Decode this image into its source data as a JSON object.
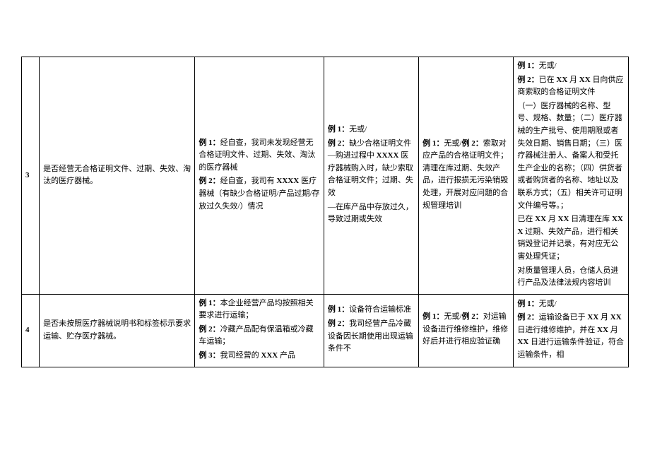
{
  "rows": [
    {
      "num": "3",
      "question": "是否经营无合格证明文件、过期、失效、淘汰的医疗器械。",
      "col3": {
        "p1a": "例 1：",
        "p1b": "经自查，我司未发现经营无合格证明文件、过期、失效、淘汰的医疗器械",
        "p2a": "例 2：",
        "p2b": "经自查，我司有 ",
        "p2c": "XXXX",
        "p2d": " 医疗器械（有缺少合格证明/产品过期/存放过久失效/）情况"
      },
      "col4": {
        "p1a": "例 1：",
        "p1b": "无或/",
        "p2a": "例 2：",
        "p2b": "缺少合格证明文件—购进过程中 ",
        "p2c": "XXXX",
        "p2d": " 医疗器械购入时，缺少索取合格证明文件；过期、失效",
        "p3": "—在库产品中存放过久，导致过期或失效"
      },
      "col5": {
        "p1a": "例 1：",
        "p1b": "无或/",
        "p1c": "例 2：",
        "p1d": "索取对应产品的合格证明文件；清理在库过期、失效产品，进行报损无污染销毁处理，开展对应问题的合规管理培训"
      },
      "col6": {
        "p1a": "例 1：",
        "p1b": "无或/",
        "p2a": "例 2：",
        "p2b": "已在 ",
        "p2c": "XX",
        "p2d": " 月 ",
        "p2e": "XX",
        "p2f": " 日向供应商索取的合格证明文件",
        "p3": "（一）医疗器械的名称、型号、规格、数量；（二）医疗器械的生产批号、使用期限或者失效日期、销售日期；（三）医疗器械注册人、备案人和受托生产企业的名称；（四）供货者或者购货者的名称、地址以及联系方式；（五）相关许可证明文件编号等。；",
        "p4a": "已在 ",
        "p4b": "XX",
        "p4c": " 月 ",
        "p4d": "XX",
        "p4e": " 日清理在库 ",
        "p4f": "XXX",
        "p4g": " 过期、失效产品，进行相关销毁登记并记录，有对应无公害处理凭证；",
        "p5": "对质量管理人员，仓储人员进行产品及法律法规内容培训"
      }
    },
    {
      "num": "4",
      "question": "是否未按照医疗器械说明书和标签标示要求运输、贮存医疗器械。",
      "col3": {
        "p1a": "例 1：",
        "p1b": "本企业经营产品均按照相关要求进行运输；",
        "p2a": "例 2：",
        "p2b": "冷藏产品配有保温箱或冷藏车运输；",
        "p3a": "例 3：",
        "p3b": "我司经营的 ",
        "p3c": "XXX",
        "p3d": " 产品"
      },
      "col4": {
        "p1a": "例 1：",
        "p1b": "设备符合运输标准",
        "p2a": "例 2：",
        "p2b": "我司经营产品冷藏设备因长期使用出现运输条件不"
      },
      "col5": {
        "p1a": "例 1：",
        "p1b": "无或/",
        "p1c": "例 2：",
        "p1d": "对运输设备进行维修维护，维修好后并进行相应验证确"
      },
      "col6": {
        "p1a": "例 1：",
        "p1b": "无或/",
        "p2a": "例 2：",
        "p2b": "运输设备已于 ",
        "p2c": "XX",
        "p2d": " 月 ",
        "p2e": "XX",
        "p2f": " 日进行维修维护，并在 ",
        "p2g": "XX",
        "p2h": " 月 ",
        "p2i": "XX",
        "p2j": " 日进行运输条件验证，符合运输条件，相"
      }
    }
  ]
}
